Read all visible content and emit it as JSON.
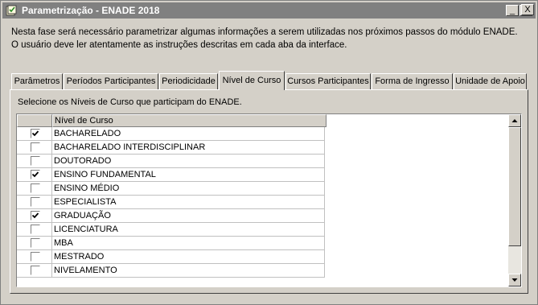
{
  "window": {
    "title": "Parametrização - ENADE  2018",
    "controls": {
      "minimize": "_",
      "maximize": "□",
      "close": "X"
    }
  },
  "intro": {
    "line1": "Nesta fase será necessário parametrizar algumas informações a serem utilizadas nos próximos passos do módulo ENADE.",
    "line2": "O usuário deve ler atentamente as instruções descritas em cada aba da interface."
  },
  "tabs": [
    {
      "label": "Parâmetros",
      "active": false
    },
    {
      "label": "Períodos Participantes",
      "active": false
    },
    {
      "label": "Periodicidade",
      "active": false
    },
    {
      "label": "Nível de Curso",
      "active": true
    },
    {
      "label": "Cursos Participantes",
      "active": false
    },
    {
      "label": "Forma de Ingresso",
      "active": false
    },
    {
      "label": "Unidade de Apoio",
      "active": false
    }
  ],
  "panel": {
    "instruction": "Selecione os Níveis de Curso que participam do ENADE.",
    "grid": {
      "columns": [
        "",
        "Nível de Curso"
      ],
      "rows": [
        {
          "label": "BACHARELADO",
          "checked": true
        },
        {
          "label": "BACHARELADO INTERDISCIPLINAR",
          "checked": false
        },
        {
          "label": "DOUTORADO",
          "checked": false
        },
        {
          "label": "ENSINO FUNDAMENTAL",
          "checked": true
        },
        {
          "label": "ENSINO MÉDIO",
          "checked": false
        },
        {
          "label": "ESPECIALISTA",
          "checked": false
        },
        {
          "label": "GRADUAÇÃO",
          "checked": true
        },
        {
          "label": "LICENCIATURA",
          "checked": false
        },
        {
          "label": "MBA",
          "checked": false
        },
        {
          "label": "MESTRADO",
          "checked": false
        },
        {
          "label": "NIVELAMENTO",
          "checked": false
        }
      ]
    }
  },
  "icons": {
    "app": "app-window-icon",
    "scroll_up": "scroll-up-arrow-icon",
    "scroll_down": "scroll-down-arrow-icon",
    "check": "checkmark-icon"
  }
}
